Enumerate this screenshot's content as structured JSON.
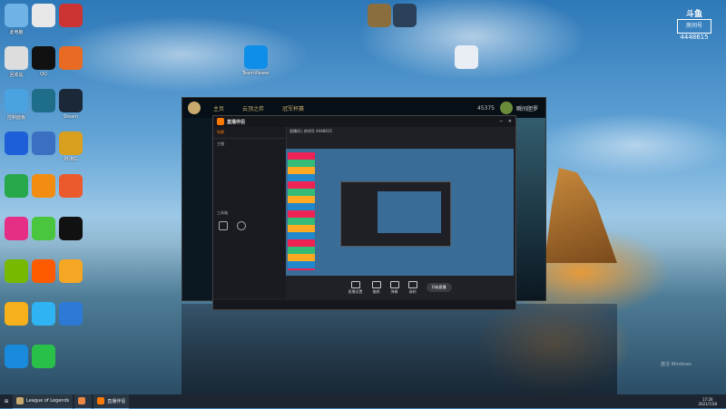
{
  "desktop_icons": [
    {
      "label": "此电脑",
      "color": "#6fb2e6"
    },
    {
      "label": "",
      "color": "#e8e8e8"
    },
    {
      "label": "",
      "color": "#c33"
    },
    {
      "label": "回收站",
      "color": "#ddd"
    },
    {
      "label": "QQ",
      "color": "#111"
    },
    {
      "label": "",
      "color": "#e96b23"
    },
    {
      "label": "控制面板",
      "color": "#4aa3e0"
    },
    {
      "label": "",
      "color": "#1e6e8a"
    },
    {
      "label": "Steam",
      "color": "#1b2838"
    },
    {
      "label": "",
      "color": "#1e5fd8"
    },
    {
      "label": "",
      "color": "#3a6fc2"
    },
    {
      "label": "PUBG",
      "color": "#d9a020"
    },
    {
      "label": "",
      "color": "#27a84a"
    },
    {
      "label": "",
      "color": "#f38d12"
    },
    {
      "label": "",
      "color": "#ea5a2d"
    },
    {
      "label": "",
      "color": "#e52e86"
    },
    {
      "label": "",
      "color": "#49c63d"
    },
    {
      "label": "",
      "color": "#111"
    },
    {
      "label": "",
      "color": "#76b900"
    },
    {
      "label": "",
      "color": "#ff5a00"
    },
    {
      "label": "",
      "color": "#f5a623"
    },
    {
      "label": "",
      "color": "#f5b01b"
    },
    {
      "label": "",
      "color": "#2fb3f2"
    },
    {
      "label": "",
      "color": "#2d79d6"
    },
    {
      "label": "",
      "color": "#1a8bdc"
    },
    {
      "label": "",
      "color": "#29c04a"
    }
  ],
  "mid_icons": [
    {
      "label": "TeamViewer",
      "color": "#0e8ee9"
    },
    {
      "label": "",
      "color": "#8a6e3e"
    },
    {
      "label": "",
      "color": "#2b4059"
    },
    {
      "label": "",
      "color": "#e9eef5"
    }
  ],
  "room": {
    "brand": "斗鱼",
    "label": "房间号",
    "number": "4448615"
  },
  "client": {
    "nav": [
      "主页",
      "云顶之弈",
      "冠军杯赛"
    ],
    "currency": "45375",
    "player": "瞬间胆罗"
  },
  "live": {
    "title": "直播伴侣",
    "sidebar": [
      "场景",
      "",
      ""
    ],
    "scene": "主播",
    "side_label": "工具箱",
    "room_title": "直播间 | 房间号 4448615",
    "tools": [
      "直播设置",
      "美颜",
      "弹幕",
      "",
      "录制",
      "",
      "",
      "开始直播"
    ],
    "status": "",
    "start_button": "开始直播"
  },
  "taskbar": {
    "items": [
      "League of Legends",
      "",
      "直播伴侣"
    ],
    "time": "17:26",
    "date": "2021/7/28"
  },
  "watermark": "激活 Windows"
}
